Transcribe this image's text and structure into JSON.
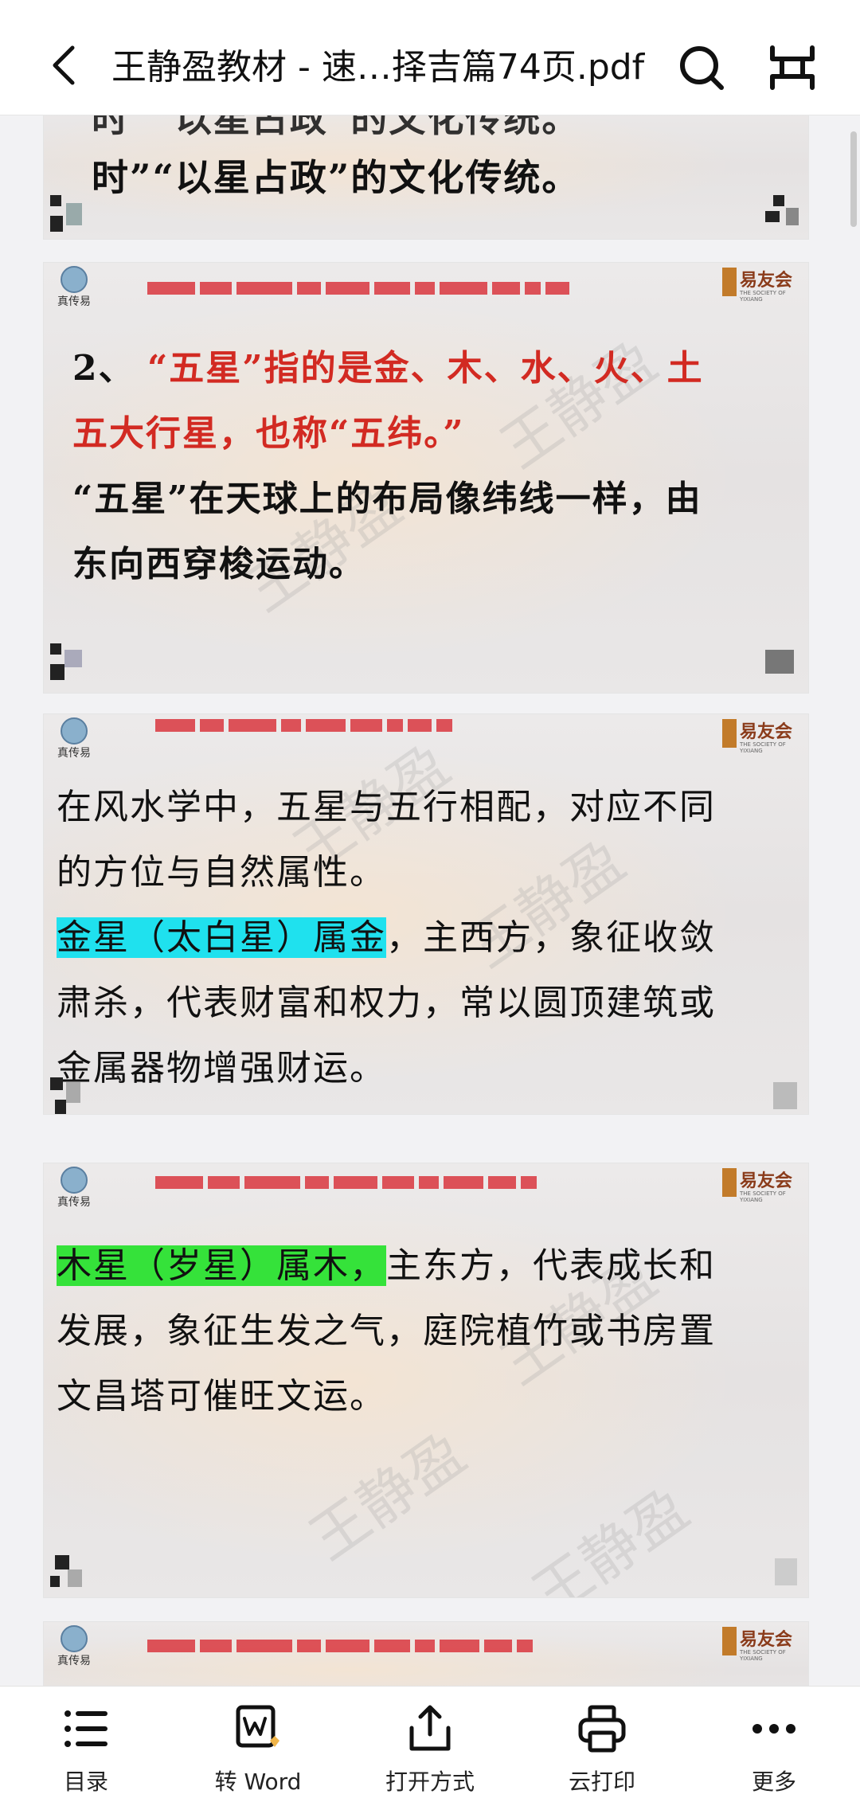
{
  "header": {
    "title": "王静盈教材 - 速…择吉篇74页.pdf",
    "back_icon": "back-chevron-icon",
    "search_icon": "search-icon",
    "expand_icon": "expand-icon"
  },
  "slides": {
    "s0": {
      "line1": "时”“以星占政”的文化传统。"
    },
    "s1": {
      "logo_left": "真传易",
      "logo_right": "易友会",
      "logo_right_sub": "THE SOCIETY OF YIXIANG",
      "num": "2、",
      "red_line1": "“五星”指的是金、木、水、火、土",
      "red_line2": "五大行星，也称“五纬。”",
      "line3": "“五星”在天球上的布局像纬线一样，由",
      "line4": "东向西穿梭运动。",
      "watermark": "王静盈"
    },
    "s2": {
      "logo_left": "真传易",
      "logo_right": "易友会",
      "logo_right_sub": "THE SOCIETY OF YIXIANG",
      "line1": "在风水学中，五星与五行相配，对应不同",
      "line2": "的方位与自然属性。",
      "hl": "金星（太白星）属金",
      "line3_rest": "，主西方，象征收敛",
      "line4": "肃杀，代表财富和权力，常以圆顶建筑或",
      "line5": "金属器物增强财运。",
      "watermark": "王静盈"
    },
    "s3": {
      "logo_left": "真传易",
      "logo_right": "易友会",
      "logo_right_sub": "THE SOCIETY OF YIXIANG",
      "hl": "木星（岁星）属木，",
      "line1_rest": "主东方，代表成长和",
      "line2": "发展，象征生发之气，庭院植竹或书房置",
      "line3": "文昌塔可催旺文运。",
      "watermark": "王静盈"
    },
    "s4": {
      "logo_left": "真传易",
      "logo_right": "易友会",
      "logo_right_sub": "THE SOCIETY OF YIXIANG"
    }
  },
  "toolbar": {
    "items": [
      {
        "label": "目录",
        "icon": "list-icon"
      },
      {
        "label": "转 Word",
        "icon": "convert-word-icon"
      },
      {
        "label": "打开方式",
        "icon": "share-upload-icon"
      },
      {
        "label": "云打印",
        "icon": "printer-icon"
      },
      {
        "label": "更多",
        "icon": "more-dots-icon"
      }
    ]
  },
  "colors": {
    "red_text": "#d22a22",
    "cyan_highlight": "#1fe1ee",
    "green_highlight": "#35e23a",
    "red_bar": "#d9363e"
  }
}
